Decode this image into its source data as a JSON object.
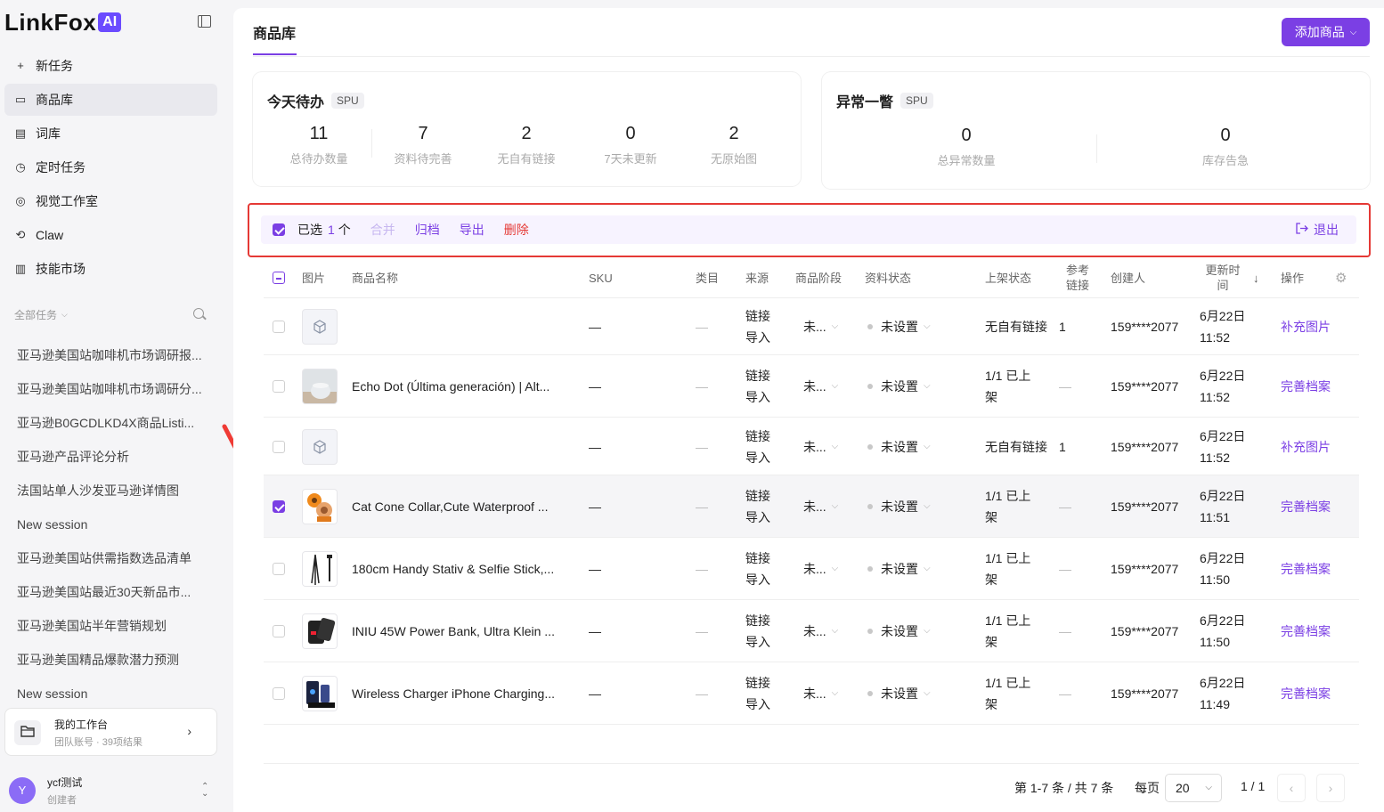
{
  "brand": {
    "name": "LinkFox",
    "badge": "AI"
  },
  "nav": [
    {
      "label": "新任务",
      "icon": "plus-icon"
    },
    {
      "label": "商品库",
      "icon": "box-icon",
      "active": true
    },
    {
      "label": "词库",
      "icon": "book-icon"
    },
    {
      "label": "定时任务",
      "icon": "clock-icon"
    },
    {
      "label": "视觉工作室",
      "icon": "palette-icon"
    },
    {
      "label": "Claw",
      "icon": "claw-icon"
    },
    {
      "label": "技能市场",
      "icon": "library-icon"
    }
  ],
  "tasks_section": {
    "label": "全部任务"
  },
  "tasks": [
    "亚马逊美国站咖啡机市场调研报...",
    "亚马逊美国站咖啡机市场调研分...",
    "亚马逊B0GCDLKD4X商品Listi...",
    "亚马逊产品评论分析",
    "法国站单人沙发亚马逊详情图",
    "New session",
    "亚马逊美国站供需指数选品清单",
    "亚马逊美国站最近30天新品市...",
    "亚马逊美国站半年营销规划",
    "亚马逊美国精品爆款潜力预测",
    "New session"
  ],
  "workspace": {
    "title": "我的工作台",
    "subtitle": "团队账号 · 39项结果"
  },
  "user": {
    "avatar": "Y",
    "name": "ycf测试",
    "role": "创建者"
  },
  "page": {
    "tab": "商品库",
    "add_button": "添加商品"
  },
  "todo": {
    "title": "今天待办",
    "tag": "SPU",
    "stats": [
      {
        "num": "11",
        "label": "总待办数量"
      },
      {
        "num": "7",
        "label": "资料待完善"
      },
      {
        "num": "2",
        "label": "无自有链接"
      },
      {
        "num": "0",
        "label": "7天未更新"
      },
      {
        "num": "2",
        "label": "无原始图"
      }
    ]
  },
  "alerts": {
    "title": "异常一瞥",
    "tag": "SPU",
    "stats": [
      {
        "num": "0",
        "label": "总异常数量"
      },
      {
        "num": "0",
        "label": "库存告急"
      }
    ]
  },
  "toolbar": {
    "selected_prefix": "已选",
    "selected_count": "1",
    "selected_suffix": "个",
    "merge": "合并",
    "archive": "归档",
    "export": "导出",
    "delete": "删除",
    "exit": "退出"
  },
  "table": {
    "headers": {
      "image": "图片",
      "name": "商品名称",
      "sku": "SKU",
      "category": "类目",
      "source": "来源",
      "stage": "商品阶段",
      "data_status": "资料状态",
      "listing": "上架状态",
      "ref_link": "参考链接",
      "creator": "创建人",
      "updated": "更新时间",
      "actions": "操作"
    },
    "rows": [
      {
        "name": "",
        "sku": "—",
        "category": "—",
        "source": "链接导入",
        "stage": "未...",
        "data_status": "未设置",
        "listing": "无自有链接",
        "ref": "1",
        "creator": "159****2077",
        "date": "6月22日",
        "time": "11:52",
        "action": "补充图片",
        "thumb": "placeholder",
        "selected": false
      },
      {
        "name": "Echo Dot (Última generación) | Alt...",
        "sku": "—",
        "category": "—",
        "source": "链接导入",
        "stage": "未...",
        "data_status": "未设置",
        "listing": "1/1 已上架",
        "ref": "—",
        "creator": "159****2077",
        "date": "6月22日",
        "time": "11:52",
        "action": "完善档案",
        "thumb": "echo",
        "selected": false
      },
      {
        "name": "",
        "sku": "—",
        "category": "—",
        "source": "链接导入",
        "stage": "未...",
        "data_status": "未设置",
        "listing": "无自有链接",
        "ref": "1",
        "creator": "159****2077",
        "date": "6月22日",
        "time": "11:52",
        "action": "补充图片",
        "thumb": "placeholder",
        "selected": false
      },
      {
        "name": "Cat Cone Collar,Cute Waterproof ...",
        "sku": "—",
        "category": "—",
        "source": "链接导入",
        "stage": "未...",
        "data_status": "未设置",
        "listing": "1/1 已上架",
        "ref": "—",
        "creator": "159****2077",
        "date": "6月22日",
        "time": "11:51",
        "action": "完善档案",
        "thumb": "cat",
        "selected": true
      },
      {
        "name": "180cm Handy Stativ & Selfie Stick,...",
        "sku": "—",
        "category": "—",
        "source": "链接导入",
        "stage": "未...",
        "data_status": "未设置",
        "listing": "1/1 已上架",
        "ref": "—",
        "creator": "159****2077",
        "date": "6月22日",
        "time": "11:50",
        "action": "完善档案",
        "thumb": "tripod",
        "selected": false
      },
      {
        "name": "INIU 45W Power Bank, Ultra Klein ...",
        "sku": "—",
        "category": "—",
        "source": "链接导入",
        "stage": "未...",
        "data_status": "未设置",
        "listing": "1/1 已上架",
        "ref": "—",
        "creator": "159****2077",
        "date": "6月22日",
        "time": "11:50",
        "action": "完善档案",
        "thumb": "powerbank",
        "selected": false
      },
      {
        "name": "Wireless Charger iPhone Charging...",
        "sku": "—",
        "category": "—",
        "source": "链接导入",
        "stage": "未...",
        "data_status": "未设置",
        "listing": "1/1 已上架",
        "ref": "—",
        "creator": "159****2077",
        "date": "6月22日",
        "time": "11:49",
        "action": "完善档案",
        "thumb": "charger",
        "selected": false
      }
    ]
  },
  "pagination": {
    "summary": "第 1-7 条 / 共 7 条",
    "per_page_label": "每页",
    "per_page": "20",
    "page": "1 / 1",
    "prev": "‹",
    "next": "›"
  },
  "colors": {
    "accent": "#7b3fe4",
    "danger": "#e53935"
  }
}
